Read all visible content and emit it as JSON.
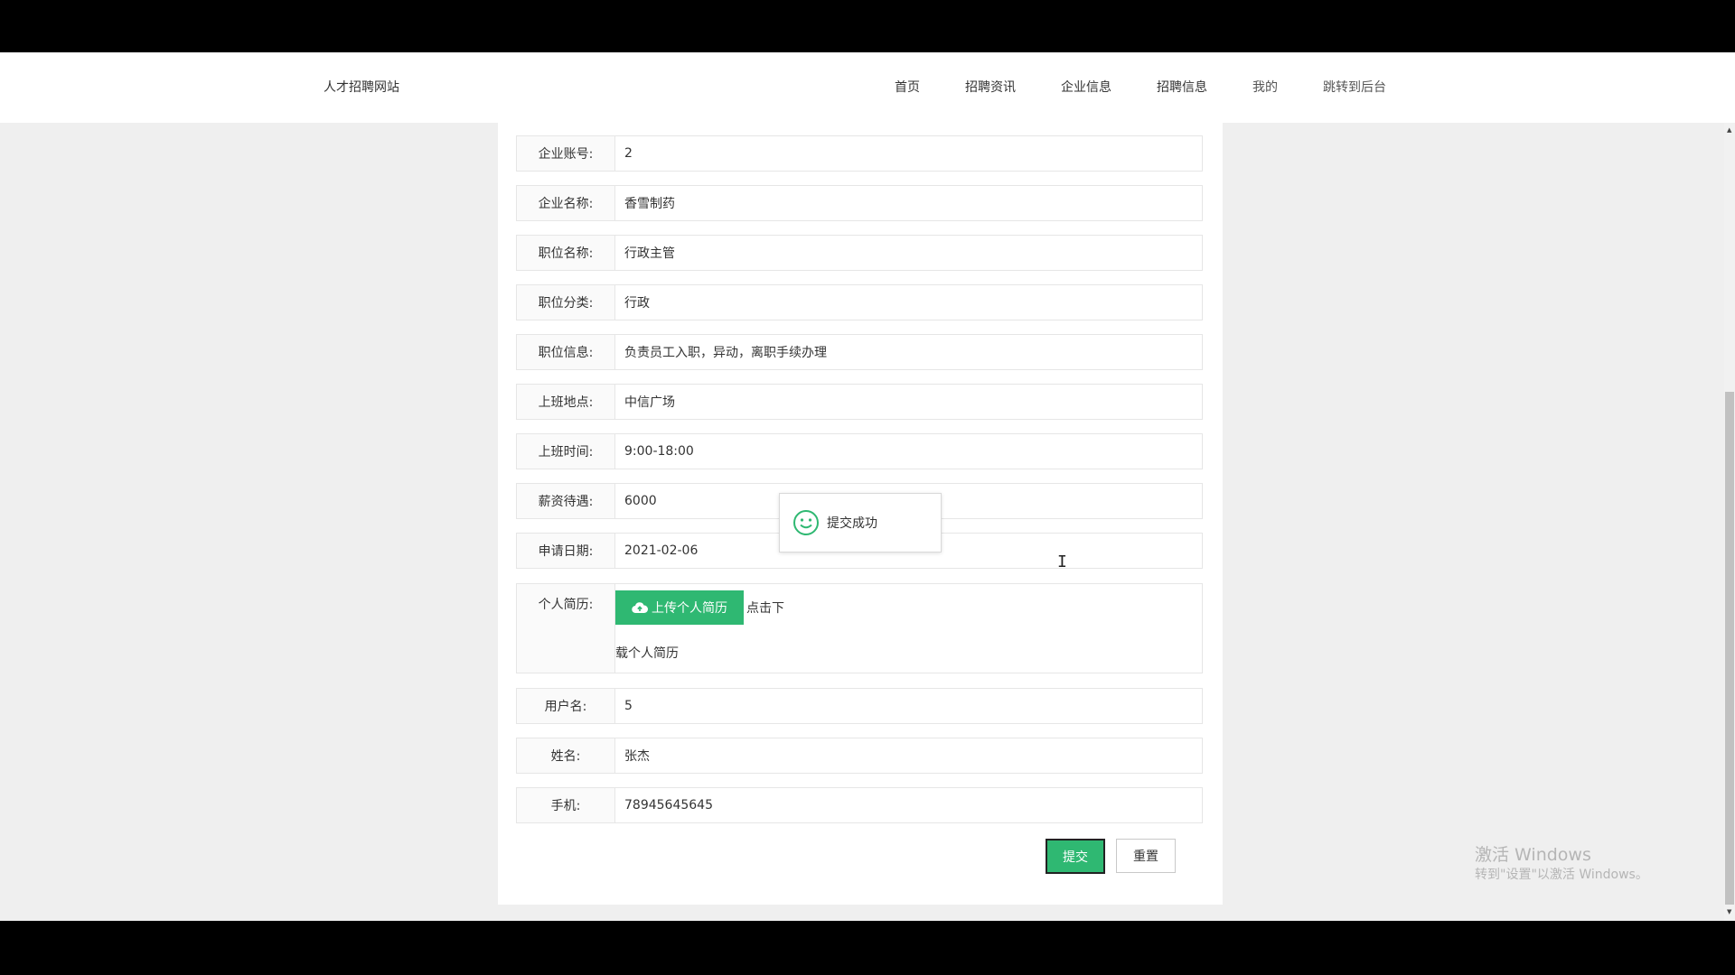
{
  "site": {
    "brand": "人才招聘网站"
  },
  "nav": {
    "items": [
      {
        "label": "首页"
      },
      {
        "label": "招聘资讯"
      },
      {
        "label": "企业信息"
      },
      {
        "label": "招聘信息"
      },
      {
        "label": "我的"
      },
      {
        "label": "跳转到后台"
      }
    ]
  },
  "form": {
    "fields": [
      {
        "label": "企业账号:",
        "value": "2"
      },
      {
        "label": "企业名称:",
        "value": "香雪制药"
      },
      {
        "label": "职位名称:",
        "value": "行政主管"
      },
      {
        "label": "职位分类:",
        "value": "行政"
      },
      {
        "label": "职位信息:",
        "value": "负责员工入职，异动，离职手续办理"
      },
      {
        "label": "上班地点:",
        "value": "中信广场"
      },
      {
        "label": "上班时间:",
        "value": "9:00-18:00"
      },
      {
        "label": "薪资待遇:",
        "value": "6000"
      },
      {
        "label": "申请日期:",
        "value": "2021-02-06"
      }
    ],
    "resume": {
      "label": "个人简历:",
      "upload_label": "上传个人简历",
      "download_text_1": "点击下",
      "download_text_2": "载个人简历"
    },
    "fields_after": [
      {
        "label": "用户名:",
        "value": "5"
      },
      {
        "label": "姓名:",
        "value": "张杰"
      },
      {
        "label": "手机:",
        "value": "78945645645"
      }
    ],
    "submit_label": "提交",
    "reset_label": "重置"
  },
  "toast": {
    "message": "提交成功",
    "icon": "smile-icon"
  },
  "watermark": {
    "line1": "激活 Windows",
    "line2": "转到\"设置\"以激活 Windows。"
  },
  "colors": {
    "primary": "#2fb872",
    "page_bg": "#efefef"
  }
}
